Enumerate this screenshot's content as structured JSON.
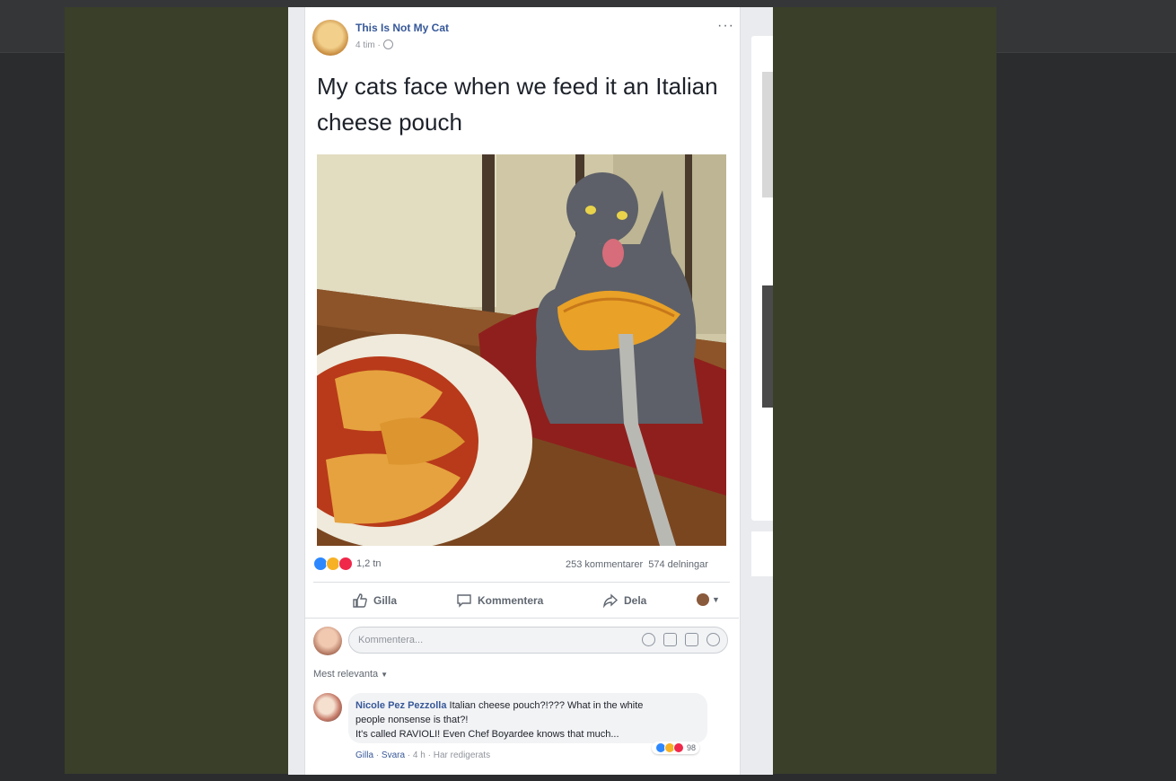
{
  "post": {
    "page_name": "This Is Not My Cat",
    "time": "4 tim ·",
    "more": "···",
    "text": "My cats face when we feed it an Italian cheese pouch",
    "reaction_count": "1,2 tn",
    "comments_count": "253 kommentarer",
    "shares_count": "574 delningar",
    "actions": {
      "like": "Gilla",
      "comment": "Kommentera",
      "share": "Dela"
    }
  },
  "composer": {
    "placeholder": "Kommentera..."
  },
  "sort": {
    "label": "Mest relevanta"
  },
  "comment": {
    "author": "Nicole Pez Pezzolla",
    "line1": "Italian cheese pouch?!??? What in the white",
    "line2": "people nonsense is that?!",
    "line3": "It's called RAVIOLI! Even Chef Boyardee knows that much...",
    "reaction_count": "98",
    "like": "Gilla",
    "reply": "Svara",
    "time": "4 h",
    "edited": "Har redigerats"
  },
  "colors": {
    "link": "#365899",
    "overlay": "#3a3f29",
    "like_blue": "#2d88ff",
    "love_red": "#f0284a",
    "haha_yellow": "#f7b125"
  },
  "icons": [
    "globe-icon",
    "thumbs-up-icon",
    "comment-icon",
    "share-icon",
    "emoji-icon",
    "camera-icon",
    "gif-icon",
    "sticker-icon"
  ]
}
